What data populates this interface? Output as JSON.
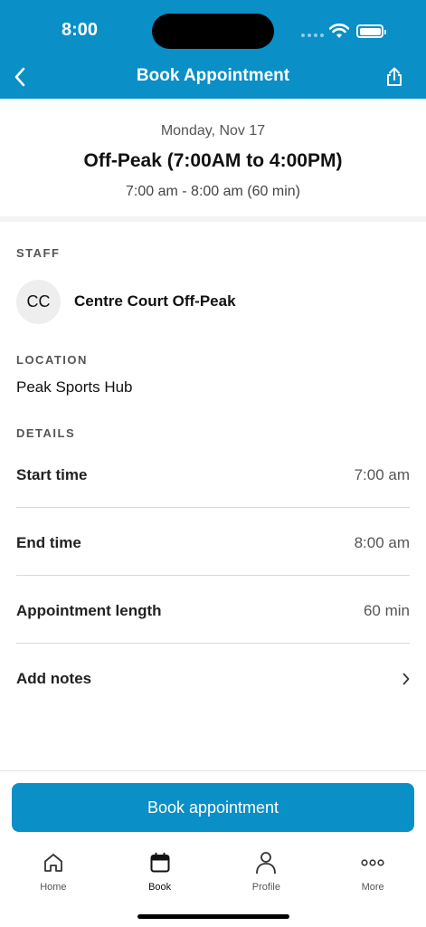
{
  "status_bar": {
    "time": "8:00"
  },
  "nav": {
    "title": "Book Appointment"
  },
  "summary": {
    "date": "Monday, Nov 17",
    "title": "Off-Peak (7:00AM to 4:00PM)",
    "time_range": "7:00 am - 8:00 am (60 min)"
  },
  "staff": {
    "section_label": "STAFF",
    "initials": "CC",
    "name": "Centre Court Off-Peak"
  },
  "location": {
    "section_label": "LOCATION",
    "name": "Peak Sports Hub"
  },
  "details": {
    "section_label": "DETAILS",
    "rows": [
      {
        "label": "Start time",
        "value": "7:00 am"
      },
      {
        "label": "End time",
        "value": "8:00 am"
      },
      {
        "label": "Appointment length",
        "value": "60 min"
      }
    ],
    "notes_label": "Add notes"
  },
  "actions": {
    "book_label": "Book appointment"
  },
  "tabs": [
    {
      "label": "Home",
      "icon": "home-icon"
    },
    {
      "label": "Book",
      "icon": "calendar-icon"
    },
    {
      "label": "Profile",
      "icon": "person-icon"
    },
    {
      "label": "More",
      "icon": "more-icon"
    }
  ],
  "colors": {
    "brand": "#0a8fc7"
  }
}
